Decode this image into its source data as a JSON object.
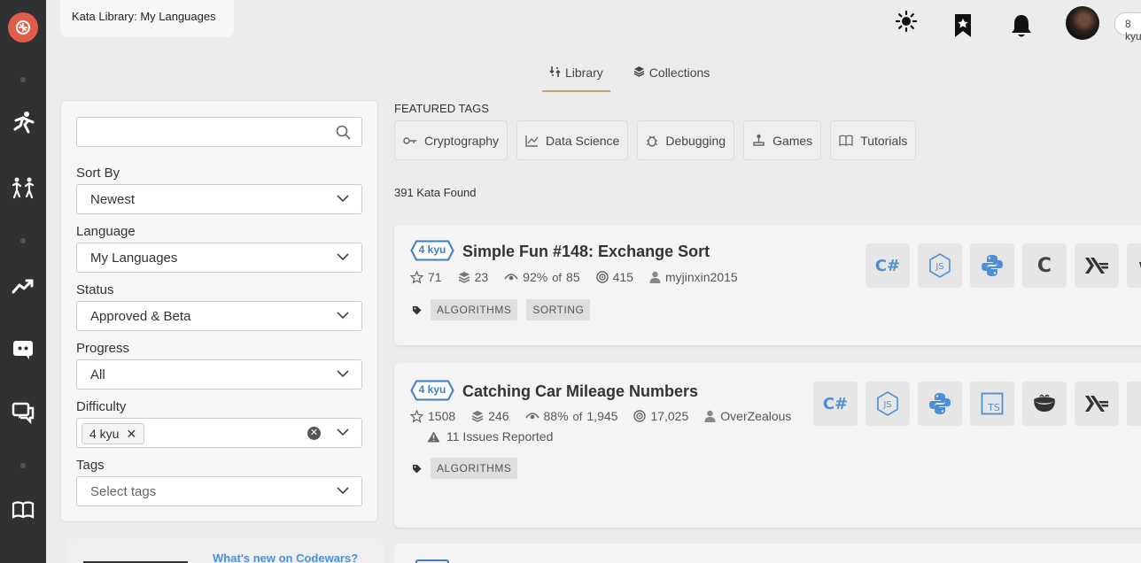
{
  "page": {
    "title": "Kata Library: My Languages",
    "rank_badge": "8 kyu"
  },
  "nav_icons": [
    "codewars-logo-icon",
    "training-icon",
    "practice-icon",
    "leaderboard-icon",
    "discord-icon",
    "discussions-icon",
    "docs-icon"
  ],
  "top_icons": [
    "theme-sun-icon",
    "bookmark-icon",
    "notification-bell-icon"
  ],
  "tabs": [
    {
      "label": "Library",
      "icon": "library-icon",
      "active": true
    },
    {
      "label": "Collections",
      "icon": "collections-icon",
      "active": false
    }
  ],
  "filters": {
    "search_placeholder": "",
    "sort_by": {
      "label": "Sort By",
      "value": "Newest"
    },
    "language": {
      "label": "Language",
      "value": "My Languages"
    },
    "status": {
      "label": "Status",
      "value": "Approved & Beta"
    },
    "progress": {
      "label": "Progress",
      "value": "All"
    },
    "difficulty": {
      "label": "Difficulty",
      "chip": "4 kyu"
    },
    "tags": {
      "label": "Tags",
      "placeholder": "Select tags"
    }
  },
  "whats_new": "What's new on Codewars?",
  "featured": {
    "title": "FEATURED TAGS",
    "tags": [
      {
        "label": "Cryptography",
        "icon": "key-icon"
      },
      {
        "label": "Data Science",
        "icon": "chart-icon"
      },
      {
        "label": "Debugging",
        "icon": "bug-icon"
      },
      {
        "label": "Games",
        "icon": "joystick-icon"
      },
      {
        "label": "Tutorials",
        "icon": "book-icon"
      }
    ]
  },
  "found": "391 Kata Found",
  "katas": [
    {
      "kyu": "4 kyu",
      "title": "Simple Fun #148: Exchange Sort",
      "stars": "71",
      "collections": "23",
      "satisfaction": "92%",
      "of": "of",
      "votes": "85",
      "completed": "415",
      "author": "myjinxin2015",
      "issues": "",
      "tags": [
        "ALGORITHMS",
        "SORTING"
      ],
      "languages": [
        "csharp",
        "javascript",
        "python",
        "c",
        "haskell"
      ]
    },
    {
      "kyu": "4 kyu",
      "title": "Catching Car Mileage Numbers",
      "stars": "1508",
      "collections": "246",
      "satisfaction": "88%",
      "of": "of",
      "votes": "1,945",
      "completed": "17,025",
      "author": "OverZealous",
      "issues": "11 Issues Reported",
      "tags": [
        "ALGORITHMS"
      ],
      "languages": [
        "csharp",
        "javascript",
        "python",
        "typescript",
        "coffeescript",
        "haskell"
      ]
    }
  ]
}
